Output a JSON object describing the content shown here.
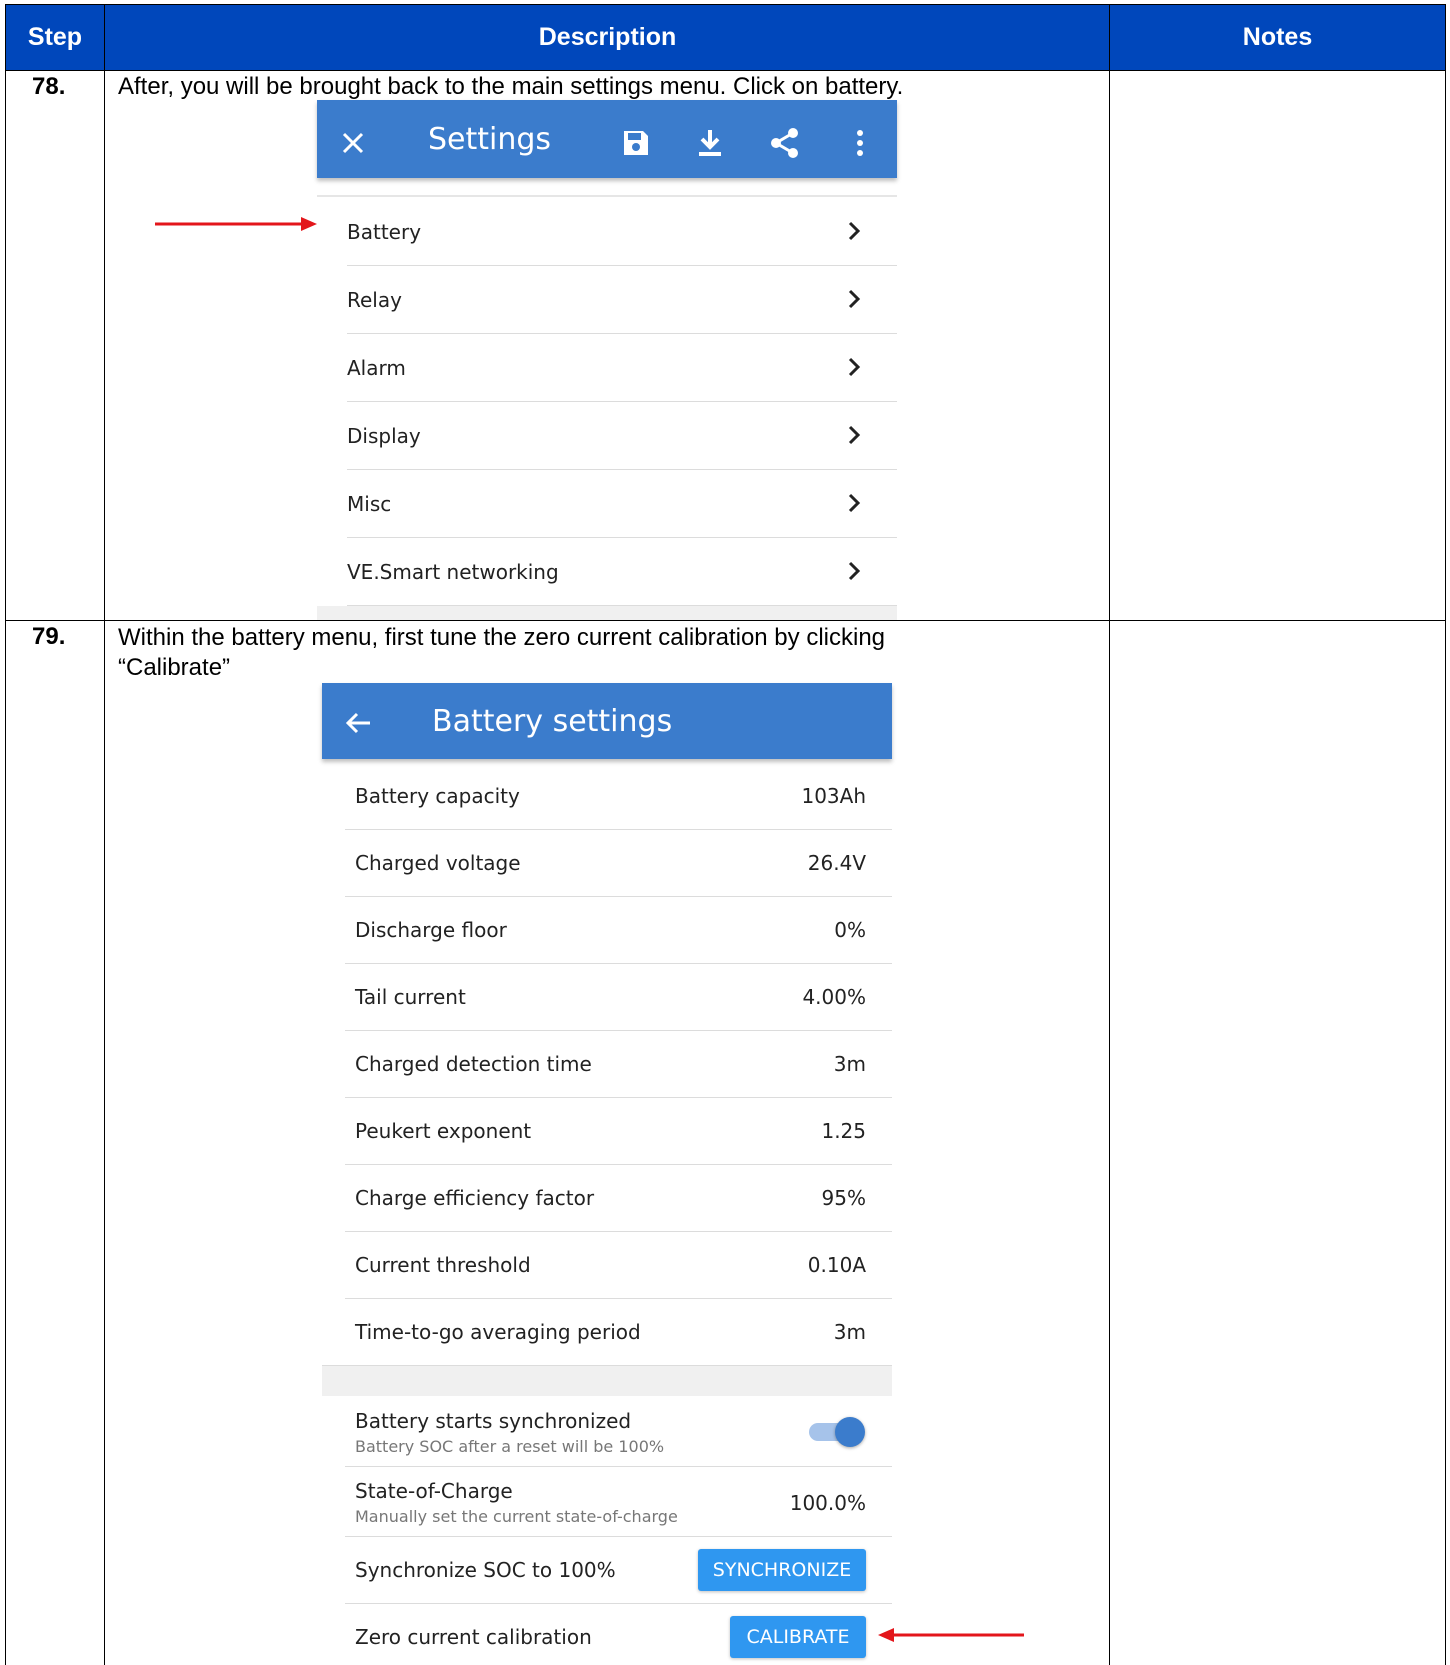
{
  "table": {
    "headers": {
      "step": "Step",
      "description": "Description",
      "notes": "Notes"
    },
    "rows": [
      {
        "step": "78.",
        "description": "After, you will be brought back to the main settings menu. Click on battery."
      },
      {
        "step": "79.",
        "description_line1": "Within the battery menu, first tune the zero current calibration by clicking",
        "description_line2": "“Calibrate”"
      }
    ]
  },
  "settings_screen": {
    "title": "Settings",
    "icons": [
      "close-icon",
      "save-icon",
      "download-icon",
      "share-icon",
      "more-vert-icon"
    ],
    "items": [
      {
        "label": "Battery"
      },
      {
        "label": "Relay"
      },
      {
        "label": "Alarm"
      },
      {
        "label": "Display"
      },
      {
        "label": "Misc"
      },
      {
        "label": "VE.Smart networking"
      }
    ]
  },
  "battery_screen": {
    "title": "Battery settings",
    "rows": [
      {
        "label": "Battery capacity",
        "value": "103Ah"
      },
      {
        "label": "Charged voltage",
        "value": "26.4V"
      },
      {
        "label": "Discharge floor",
        "value": "0%"
      },
      {
        "label": "Tail current",
        "value": "4.00%"
      },
      {
        "label": "Charged detection time",
        "value": "3m"
      },
      {
        "label": "Peukert exponent",
        "value": "1.25"
      },
      {
        "label": "Charge efficiency factor",
        "value": "95%"
      },
      {
        "label": "Current threshold",
        "value": "0.10A"
      },
      {
        "label": "Time-to-go averaging period",
        "value": "3m"
      }
    ],
    "sync_start": {
      "label": "Battery starts synchronized",
      "sub": "Battery SOC after a reset will be 100%",
      "enabled": true
    },
    "soc": {
      "label": "State-of-Charge",
      "sub": "Manually set the current state-of-charge",
      "value": "100.0%"
    },
    "sync_soc": {
      "label": "Synchronize SOC to 100%",
      "button": "SYNCHRONIZE"
    },
    "zero_cal": {
      "label": "Zero current calibration",
      "button": "CALIBRATE"
    }
  },
  "colors": {
    "header_blue": "#0047bb",
    "appbar_blue": "#3b7ccc",
    "button_blue": "#2f97f0",
    "arrow_red": "#e3161b"
  }
}
